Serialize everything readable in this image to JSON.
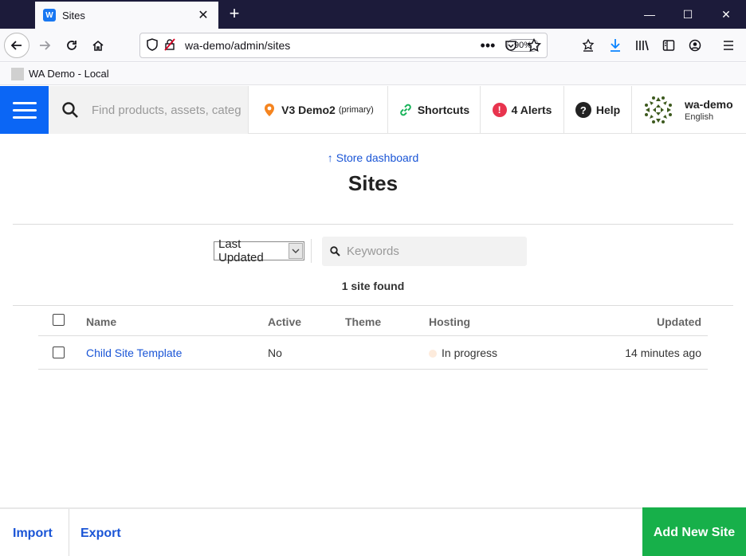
{
  "browser": {
    "tab_title": "Sites",
    "tab_favicon_letter": "W",
    "tab_close": "✕",
    "new_tab": "+",
    "url": "wa-demo/admin/sites",
    "zoom": "90%",
    "bookmark_label": "WA Demo - Local",
    "window_buttons": [
      "—",
      "☐",
      "✕"
    ]
  },
  "header": {
    "search_placeholder": "Find products, assets, categ",
    "site_name": "V3 Demo2",
    "site_tag": "(primary)",
    "shortcuts_label": "Shortcuts",
    "alerts_label": "4 Alerts",
    "alert_icon_glyph": "!",
    "help_label": "Help",
    "help_icon_glyph": "?",
    "user_name": "wa-demo",
    "user_lang": "English"
  },
  "page": {
    "breadcrumb_arrow": "↑",
    "breadcrumb_label": "Store dashboard",
    "title": "Sites",
    "sort_value": "Last Updated",
    "keywords_placeholder": "Keywords",
    "result_count": "1 site found"
  },
  "table": {
    "columns": [
      "Name",
      "Active",
      "Theme",
      "Hosting",
      "Updated"
    ],
    "rows": [
      {
        "name": "Child Site Template",
        "active": "No",
        "theme": "",
        "hosting": "In progress",
        "updated": "14 minutes ago"
      }
    ]
  },
  "footer": {
    "import_label": "Import",
    "export_label": "Export",
    "add_label": "Add New Site"
  },
  "colors": {
    "brand_blue": "#0b66f5",
    "link_blue": "#1a55d6",
    "add_green": "#17b04a",
    "alert_red": "#e8344e",
    "tabbar_dark": "#1c1b3a"
  },
  "icons": [
    "search-icon",
    "site-pin-icon",
    "shortcuts-link-icon",
    "alert-icon",
    "help-icon",
    "user-avatar-icon",
    "keywords-search-icon"
  ]
}
